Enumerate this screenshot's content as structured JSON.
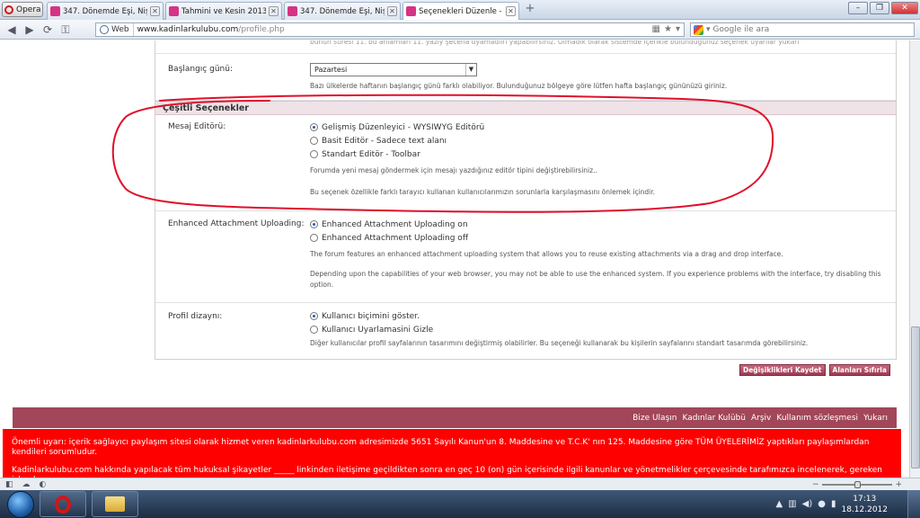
{
  "browser": {
    "menu_label": "Opera",
    "tabs": [
      {
        "label": "347. Dönemde Eşi, Nişa...",
        "active": false
      },
      {
        "label": "Tahmini ve Kesin 2013 ...",
        "active": false
      },
      {
        "label": "347. Dönemde Eşi, Nişa...",
        "active": false
      },
      {
        "label": "Seçenekleri Düzenle - K...",
        "active": true
      }
    ],
    "address": {
      "scheme_label": "Web",
      "host": "www.kadinlarkulubu.com",
      "path": "/profile.php"
    },
    "search_placeholder": "Google ile ara"
  },
  "page": {
    "cut_top_text": "bunun suresi 11. bu anlamları 11. yazıy şecena uyamadıırı yapabilirsiniz. Olmadık olarak sistemde içerikle bulunduğunuz seçenek uyarılar yukarı",
    "start_day": {
      "label": "Başlangıç günü:",
      "selected": "Pazartesi",
      "description": "Bazı ülkelerde haftanın başlangıç günü farklı olabiliyor. Bulunduğunuz bölgeye göre lütfen hafta başlangıç gününüzü giriniz."
    },
    "section_title": "Çeşitli Seçenekler",
    "message_editor": {
      "label": "Mesaj Editörü:",
      "options": [
        {
          "label": "Gelişmiş Düzenleyici - WYSIWYG Editörü",
          "checked": true
        },
        {
          "label": "Basit Editör - Sadece text alanı",
          "checked": false
        },
        {
          "label": "Standart Editör - Toolbar",
          "checked": false
        }
      ],
      "description1": "Forumda yeni mesaj göndermek için mesajı yazdığınız editör tipini değiştirebilirsiniz..",
      "description2": "Bu seçenek özellikle farklı tarayıcı kullanan kullanıcılarımızın sorunlarla karşılaşmasını önlemek içindir."
    },
    "attachment": {
      "label": "Enhanced Attachment Uploading:",
      "options": [
        {
          "label": "Enhanced Attachment Uploading on",
          "checked": true
        },
        {
          "label": "Enhanced Attachment Uploading off",
          "checked": false
        }
      ],
      "description1": "The forum features an enhanced attachment uploading system that allows you to reuse existing attachments via a drag and drop interface.",
      "description2": "Depending upon the capabilities of your web browser, you may not be able to use the enhanced system. If you experience problems with the interface, try disabling this option."
    },
    "profile_design": {
      "label": "Profil dizaynı:",
      "options": [
        {
          "label": "Kullanıcı biçimini göster.",
          "checked": true
        },
        {
          "label": "Kullanıcı Uyarlamasini Gizle",
          "checked": false
        }
      ],
      "description": "Diğer kullanıcılar profil sayfalarının tasarımını değiştirmiş olabilirler. Bu seçeneği kullanarak bu kişilerin sayfalarını standart tasarımda görebilirsiniz."
    },
    "save_button": "Değişiklikleri Kaydet",
    "reset_button": "Alanları Sıfırla",
    "footer_links": [
      "Bize Ulaşın",
      "Kadınlar Kulübü",
      "Arşiv",
      "Kullanım sözleşmesi",
      "Yukarı"
    ],
    "warning_text": "Önemli uyarı: içerik sağlayıcı paylaşım sitesi olarak hizmet veren kadinlarkulubu.com adresimizde 5651 Sayılı Kanun'un 8. Maddesine ve T.C.K' nın 125. Maddesine göre TÜM ÜYELERİMİZ yaptıkları paylaşımlardan kendileri sorumludur.",
    "warning_text2": "Kadinlarkulubu.com hakkında yapılacak tüm hukuksal şikayetler _____ linkinden iletişime geçildikten sonra en geç 10 (on) gün içerisinde ilgili kanunlar ve yönetmelikler çerçevesinde tarafımızca incelenerek, gereken işlemler"
  },
  "taskbar": {
    "time": "17:13",
    "date": "18.12.2012"
  },
  "colors": {
    "accent": "#a24659",
    "warning": "#ff0000",
    "annotation": "#e0102a"
  }
}
